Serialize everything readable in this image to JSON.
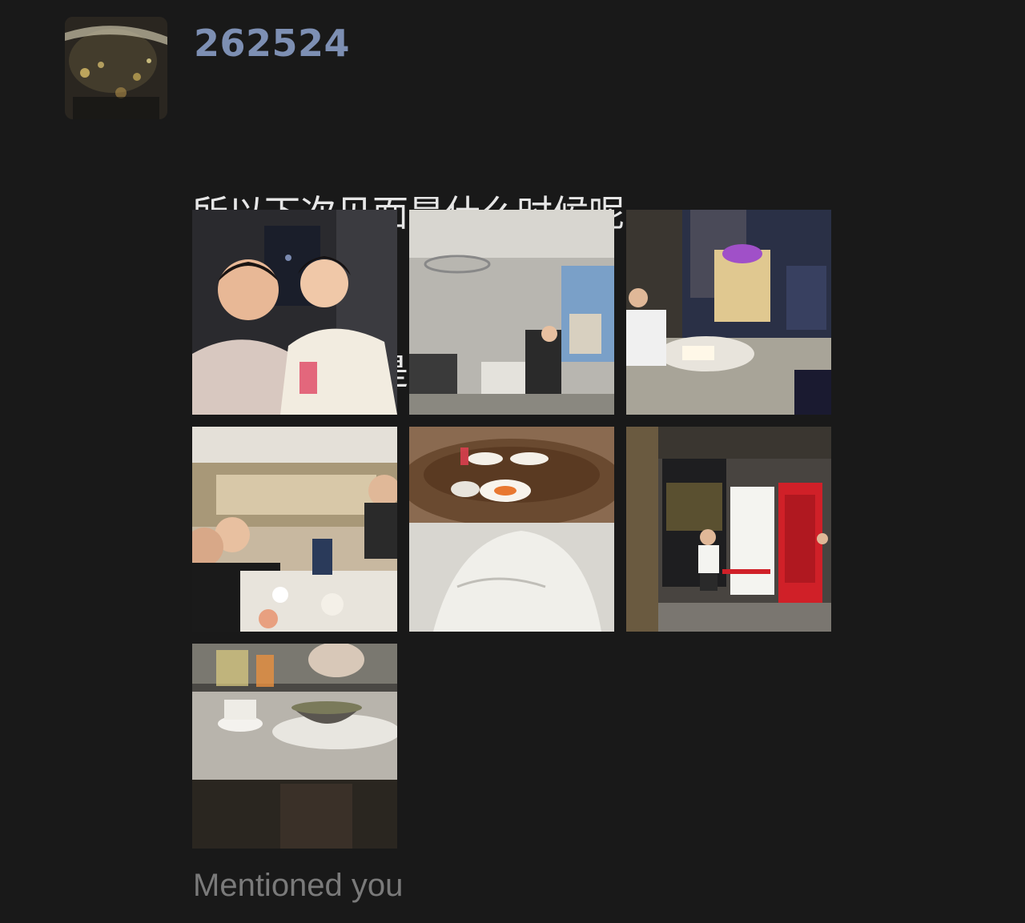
{
  "post": {
    "username": "262524",
    "message_lines": [
      "所以下次见面是什么时候呢",
      "所谓成长就是聚少离多吧"
    ],
    "mention_text": "Mentioned you"
  },
  "avatar": {
    "icon": "blurred-night-city-photo"
  },
  "photos": [
    {
      "subject": "two-friends-selfie"
    },
    {
      "subject": "hotel-gym"
    },
    {
      "subject": "rooftop-terrace-night"
    },
    {
      "subject": "group-dinner-table"
    },
    {
      "subject": "round-dining-table"
    },
    {
      "subject": "red-phone-booth"
    },
    {
      "subject": "soup-bowl-table"
    }
  ],
  "colors": {
    "background": "#191919",
    "username": "#7d8fb3",
    "message": "#e6e6e6",
    "mention": "#7a7a7a"
  }
}
